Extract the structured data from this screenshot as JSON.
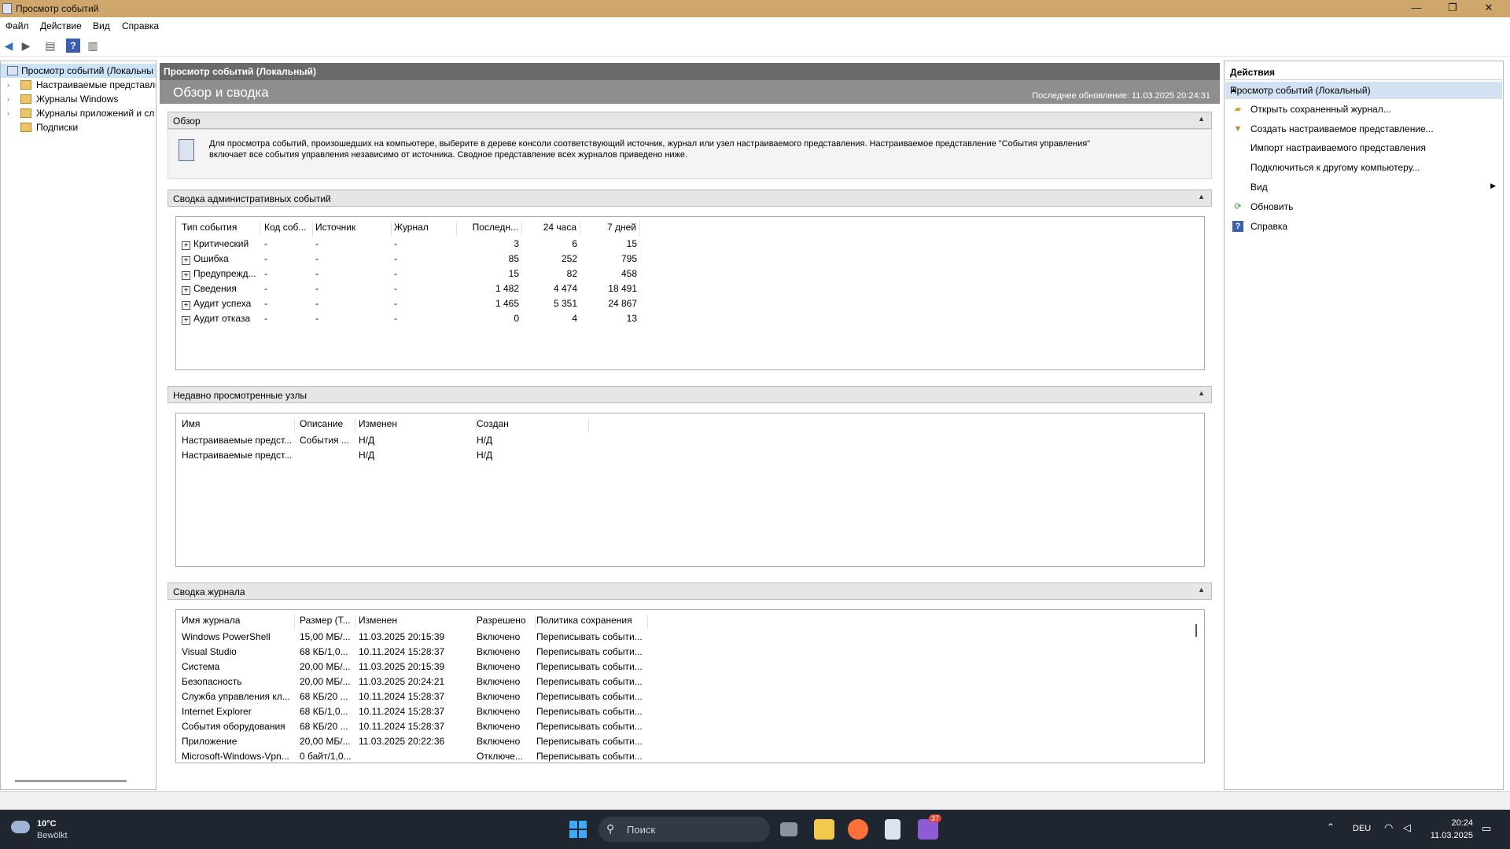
{
  "window": {
    "title": "Просмотр событий"
  },
  "menu": [
    "Файл",
    "Действие",
    "Вид",
    "Справка"
  ],
  "tree": [
    {
      "label": "Просмотр событий (Локальны",
      "selected": true
    },
    {
      "label": "Настраиваемые представле"
    },
    {
      "label": "Журналы Windows"
    },
    {
      "label": "Журналы приложений и сл"
    },
    {
      "label": "Подписки"
    }
  ],
  "center": {
    "header": "Просмотр событий (Локальный)",
    "title": "Обзор и сводка",
    "last_update": "Последнее обновление: 11.03.2025 20:24:31",
    "overview": {
      "label": "Обзор",
      "text1": "Для просмотра событий, произошедших на компьютере, выберите в дереве консоли соответствующий источник, журнал или узел настраиваемого представления. Настраиваемое представление \"События управления\"",
      "text2": "включает все события управления независимо от источника. Сводное представление всех журналов приведено ниже."
    },
    "admin_summary": {
      "label": "Сводка административных событий",
      "columns": [
        "Тип события",
        "Код соб...",
        "Источник",
        "Журнал",
        "Последн...",
        "24 часа",
        "7 дней"
      ],
      "rows": [
        [
          "Критический",
          "-",
          "-",
          "-",
          "3",
          "6",
          "15"
        ],
        [
          "Ошибка",
          "-",
          "-",
          "-",
          "85",
          "252",
          "795"
        ],
        [
          "Предупрежд...",
          "-",
          "-",
          "-",
          "15",
          "82",
          "458"
        ],
        [
          "Сведения",
          "-",
          "-",
          "-",
          "1 482",
          "4 474",
          "18 491"
        ],
        [
          "Аудит успеха",
          "-",
          "-",
          "-",
          "1 465",
          "5 351",
          "24 867"
        ],
        [
          "Аудит отказа",
          "-",
          "-",
          "-",
          "0",
          "4",
          "13"
        ]
      ]
    },
    "recent_nodes": {
      "label": "Недавно просмотренные узлы",
      "columns": [
        "Имя",
        "Описание",
        "Изменен",
        "Создан"
      ],
      "rows": [
        [
          "Настраиваемые предст...",
          "События ...",
          "Н/Д",
          "Н/Д"
        ],
        [
          "Настраиваемые предст...",
          "",
          "Н/Д",
          "Н/Д"
        ]
      ]
    },
    "log_summary": {
      "label": "Сводка журнала",
      "columns": [
        "Имя журнала",
        "Размер (Т...",
        "Изменен",
        "Разрешено",
        "Политика сохранения"
      ],
      "rows": [
        [
          "Windows PowerShell",
          "15,00 МБ/...",
          "11.03.2025 20:15:39",
          "Включено",
          "Переписывать событи..."
        ],
        [
          "Visual Studio",
          "68 КБ/1,0...",
          "10.11.2024 15:28:37",
          "Включено",
          "Переписывать событи..."
        ],
        [
          "Система",
          "20,00 МБ/...",
          "11.03.2025 20:15:39",
          "Включено",
          "Переписывать событи..."
        ],
        [
          "Безопасность",
          "20,00 МБ/...",
          "11.03.2025 20:24:21",
          "Включено",
          "Переписывать событи..."
        ],
        [
          "Служба управления кл...",
          "68 КБ/20 ...",
          "10.11.2024 15:28:37",
          "Включено",
          "Переписывать событи..."
        ],
        [
          "Internet Explorer",
          "68 КБ/1,0...",
          "10.11.2024 15:28:37",
          "Включено",
          "Переписывать событи..."
        ],
        [
          "События оборудования",
          "68 КБ/20 ...",
          "10.11.2024 15:28:37",
          "Включено",
          "Переписывать событи..."
        ],
        [
          "Приложение",
          "20,00 МБ/...",
          "11.03.2025 20:22:36",
          "Включено",
          "Переписывать событи..."
        ],
        [
          "Microsoft-Windows-Vpn...",
          "0 байт/1,0...",
          "",
          "Отключе...",
          "Переписывать событи..."
        ]
      ]
    }
  },
  "actions": {
    "header": "Действия",
    "section": "Просмотр событий (Локальный)",
    "items": [
      {
        "label": "Открыть сохраненный журнал...",
        "icon": "folder-open-icon"
      },
      {
        "label": "Создать настраиваемое представление...",
        "icon": "filter-icon"
      },
      {
        "label": "Импорт настраиваемого представления",
        "icon": ""
      },
      {
        "label": "Подключиться к другому компьютеру...",
        "icon": ""
      },
      {
        "label": "Вид",
        "icon": "",
        "submenu": true
      },
      {
        "label": "Обновить",
        "icon": "refresh-icon"
      },
      {
        "label": "Справка",
        "icon": "help-icon"
      }
    ]
  },
  "taskbar": {
    "weather_temp": "10°C",
    "weather_desc": "Bewölkt",
    "search_placeholder": "Поиск",
    "lang": "DEU",
    "time": "20:24",
    "date": "11.03.2025",
    "notif_badge": "37"
  }
}
